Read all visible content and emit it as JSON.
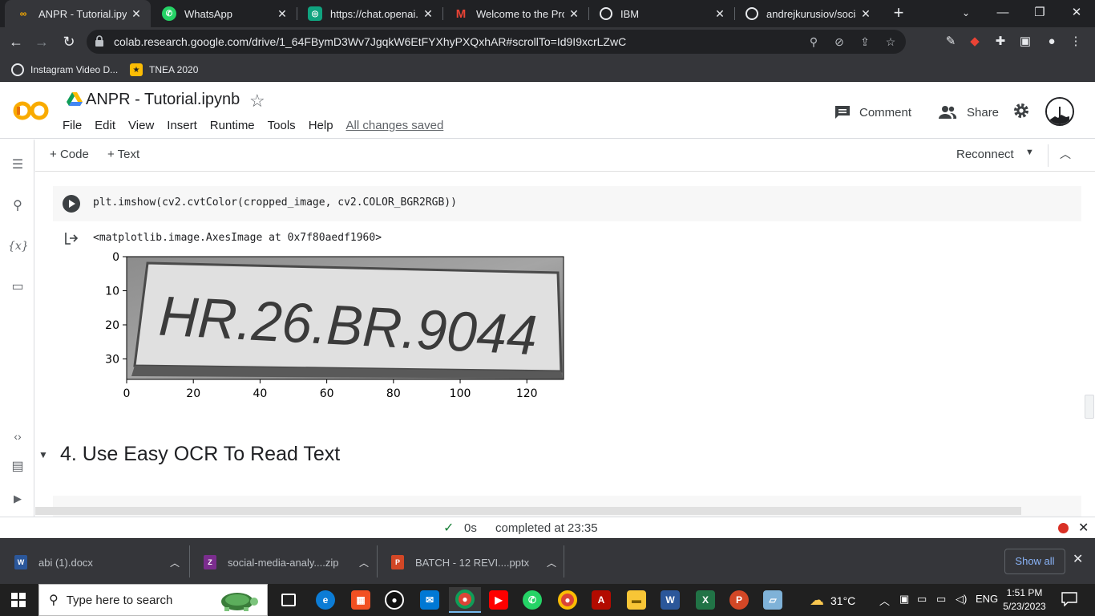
{
  "browser": {
    "tabs": [
      {
        "title": "ANPR - Tutorial.ipynb",
        "favicon": "colab-icon",
        "active": true
      },
      {
        "title": "WhatsApp",
        "favicon": "whatsapp-icon"
      },
      {
        "title": "https://chat.openai.com",
        "favicon": "openai-icon"
      },
      {
        "title": "Welcome to the Professional",
        "favicon": "gmail-icon"
      },
      {
        "title": "IBM",
        "favicon": "globe-icon"
      },
      {
        "title": "andrejkurusiov/social-media",
        "favicon": "globe-icon"
      }
    ],
    "url": "colab.research.google.com/drive/1_64FBymD3Wv7JgqkW6EtFYXhyPXQxhAR#scrollTo=Id9I9xcrLZwC",
    "bookmarks": [
      {
        "label": "Instagram Video D...",
        "icon": "instagram-icon"
      },
      {
        "label": "TNEA 2020",
        "icon": "tnea-icon"
      }
    ]
  },
  "colab": {
    "notebook_title": "ANPR - Tutorial.ipynb",
    "menu": [
      "File",
      "Edit",
      "View",
      "Insert",
      "Runtime",
      "Tools",
      "Help"
    ],
    "save_status": "All changes saved",
    "comment_label": "Comment",
    "share_label": "Share",
    "add_code_label": "Code",
    "add_text_label": "Text",
    "reconnect_label": "Reconnect",
    "code": "plt.imshow(cv2.cvtColor(cropped_image, cv2.COLOR_BGR2RGB))",
    "output_text": "<matplotlib.image.AxesImage at 0x7f80aedf1960>",
    "section_heading": "4. Use Easy OCR To Read Text",
    "status": {
      "duration": "0s",
      "completed": "completed at 23:35"
    }
  },
  "chart_data": {
    "type": "image",
    "image_text": "HR.26.BR.9044",
    "xticks": [
      0,
      20,
      40,
      60,
      80,
      100,
      120
    ],
    "yticks": [
      0,
      10,
      20,
      30
    ],
    "xlim": [
      0,
      131
    ],
    "ylim": [
      36,
      0
    ]
  },
  "downloads": [
    {
      "name": "abi (1).docx",
      "icon": "word-icon"
    },
    {
      "name": "social-media-analy....zip",
      "icon": "zip-icon"
    },
    {
      "name": "BATCH - 12  REVI....pptx",
      "icon": "pptx-icon"
    }
  ],
  "downloads_show_all": "Show all",
  "taskbar": {
    "search_placeholder": "Type here to search",
    "temperature": "31°C",
    "language": "ENG",
    "time": "1:51 PM",
    "date": "5/23/2023"
  }
}
